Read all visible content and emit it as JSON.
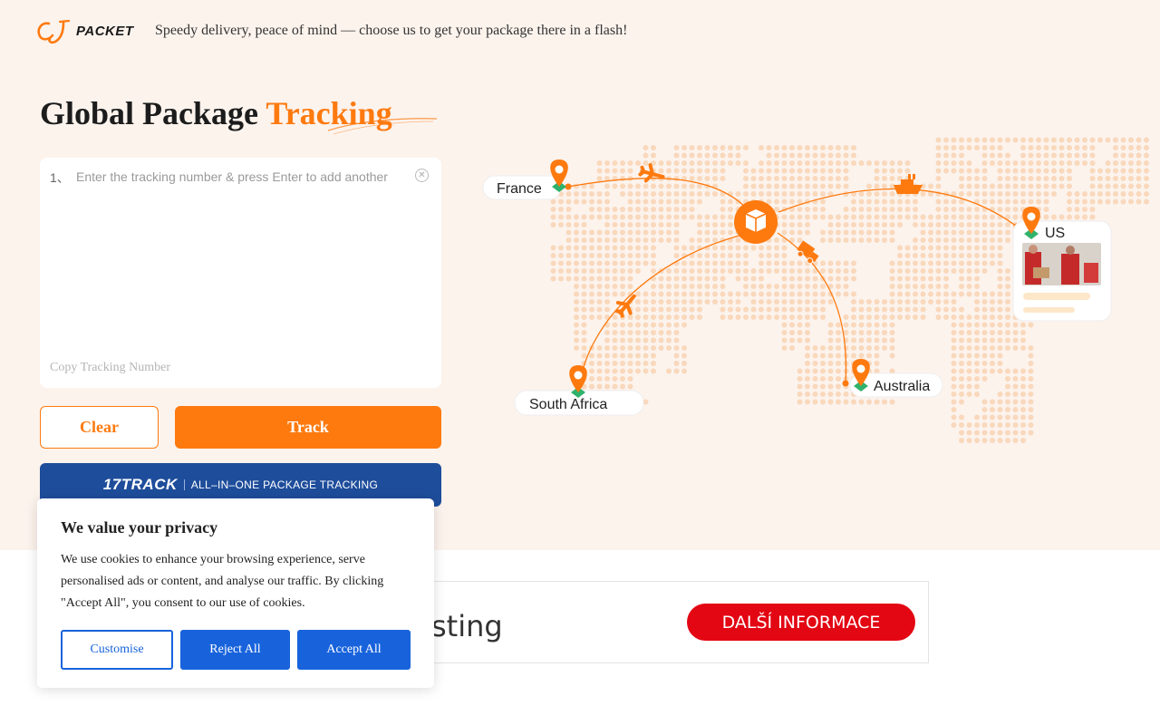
{
  "header": {
    "logo_text": "PACKET",
    "tagline": "Speedy delivery, peace of mind — choose us to get your package there in a flash!"
  },
  "hero": {
    "title_main": "Global Package",
    "title_accent": "Tracking",
    "row_number": "1、",
    "input_placeholder": "Enter the tracking number & press Enter to add another",
    "copy_link": "Copy Tracking Number",
    "clear_label": "Clear",
    "track_label": "Track"
  },
  "banner": {
    "logo": "17TRACK",
    "text": "ALL–IN–ONE PACKAGE TRACKING"
  },
  "map": {
    "locations": [
      "France",
      "US",
      "South Africa",
      "Australia"
    ],
    "accent": "#fe7a0f"
  },
  "ad": {
    "visible_text": "sting",
    "button_label": "DALŠÍ INFORMACE",
    "button_color": "#e30613"
  },
  "cookie": {
    "title": "We value your privacy",
    "body": "We use cookies to enhance your browsing experience, serve personalised ads or content, and analyse our traffic. By clicking \"Accept All\", you consent to our use of cookies.",
    "customise_label": "Customise",
    "reject_label": "Reject All",
    "accept_label": "Accept All",
    "button_color": "#1863dc"
  }
}
